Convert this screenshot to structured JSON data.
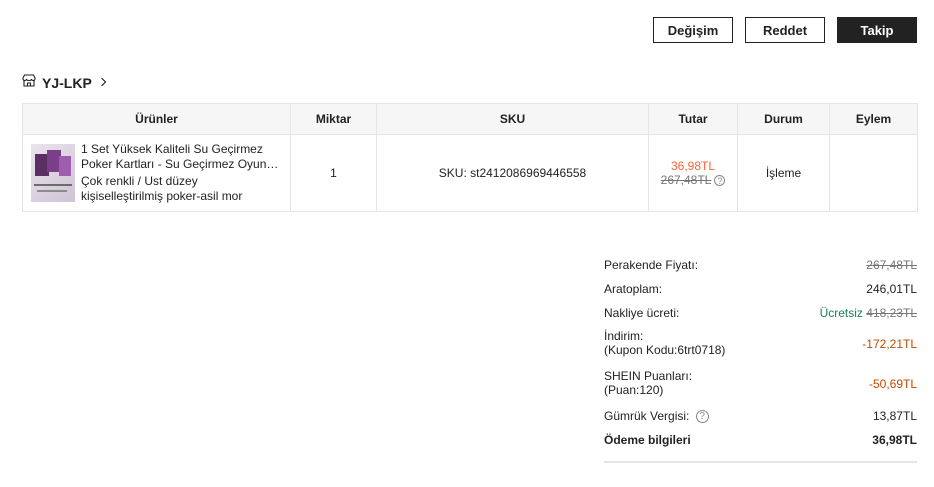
{
  "actions": {
    "exchange": "Değişim",
    "reject": "Reddet",
    "track": "Takip"
  },
  "store": {
    "name": "YJ-LKP",
    "icon": "store-icon"
  },
  "table": {
    "headers": [
      "Ürünler",
      "Miktar",
      "SKU",
      "Tutar",
      "Durum",
      "Eylem"
    ],
    "rows": [
      {
        "title": "1 Set Yüksek Kaliteli Su Geçirmez Poker Kartları - Su Geçirmez Oyun Kartları",
        "variant": "Çok renkli / Ust düzey kişiselleştirilmiş poker-asil mor",
        "quantity": "1",
        "sku": "SKU: st2412086969446558",
        "price_sale": "36,98TL",
        "price_original": "267,48TL",
        "status": "İşleme",
        "action": ""
      }
    ]
  },
  "summary": {
    "retail_label": "Perakende Fiyatı:",
    "retail_value": "267,48TL",
    "subtotal_label": "Aratoplam:",
    "subtotal_value": "246,01TL",
    "shipping_label": "Nakliye ücreti:",
    "shipping_free": "Ücretsiz",
    "shipping_original": "418,23TL",
    "discount_label": "İndirim:",
    "discount_sub": "(Kupon Kodu:6trt0718)",
    "discount_value": "-172,21TL",
    "points_label": "SHEIN Puanları:",
    "points_sub": "(Puan:120)",
    "points_value": "-50,69TL",
    "customs_label": "Gümrük Vergisi:",
    "customs_value": "13,87TL",
    "payment_label": "Ödeme bilgileri",
    "payment_value": "36,98TL"
  },
  "colors": {
    "sale": "#fa6338",
    "free": "#198055",
    "discount": "#c44a01",
    "button_dark": "#222222"
  }
}
